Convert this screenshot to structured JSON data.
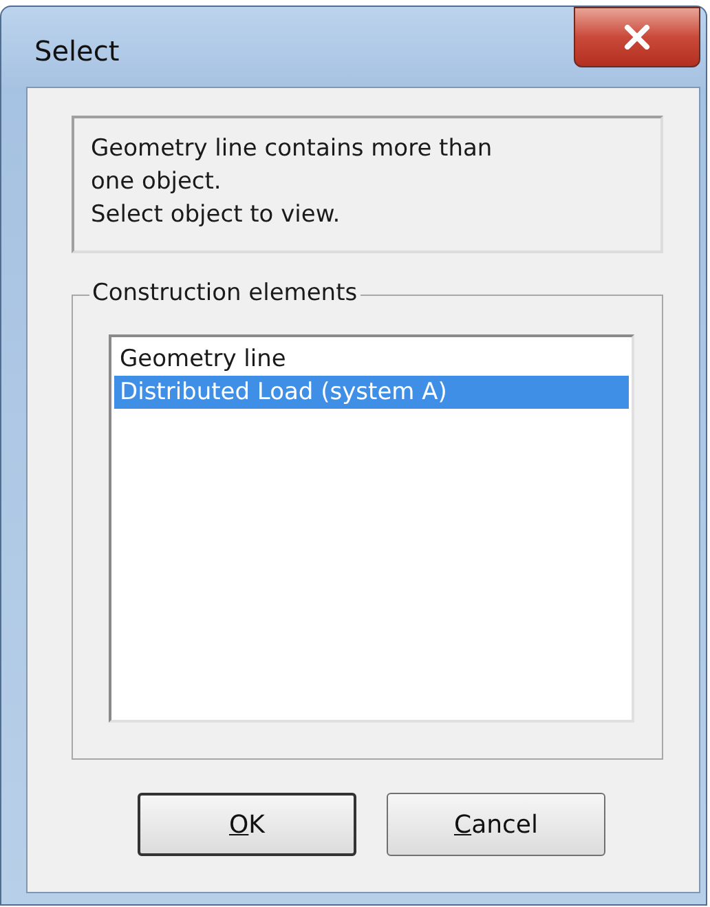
{
  "window": {
    "title": "Select"
  },
  "message": [
    "Geometry line contains more than one object.",
    "Select object to view."
  ],
  "group": {
    "title": "Construction elements",
    "items": [
      {
        "label": "Geometry line",
        "selected": false
      },
      {
        "label": "Distributed Load (system A)",
        "selected": true
      }
    ]
  },
  "buttons": [
    {
      "label_parts": [
        {
          "text": "O",
          "underlined": true
        },
        {
          "text": "K",
          "underlined": false
        }
      ],
      "default": true
    },
    {
      "label_parts": [
        {
          "text": "C",
          "underlined": true
        },
        {
          "text": "ancel",
          "underlined": false
        }
      ],
      "default": false
    }
  ]
}
